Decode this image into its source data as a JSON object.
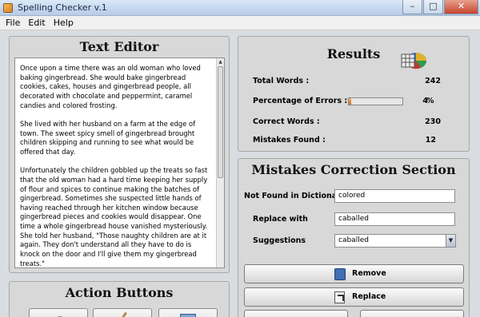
{
  "window": {
    "title": "Spelling Checker v.1",
    "minimize": "–",
    "maximize": "□",
    "close": "✕"
  },
  "menu": [
    "File",
    "Edit",
    "Help"
  ],
  "editor": {
    "title": "Text Editor",
    "paragraphs": [
      "Once upon a time there was an old woman who loved baking gingerbread. She would bake gingerbread cookies, cakes, houses and gingerbread people, all decorated with chocolate and peppermint, caramel candies and colored frosting.",
      "She lived with her husband on a farm at the edge of town. The sweet spicy smell of gingerbread brought children skipping and running to see what would be offered that day.",
      "Unfortunately the children gobbled up the treats so fast that the old woman had a hard time keeping her supply of flour and spices to continue making the batches of gingerbread. Sometimes she suspected little hands of having reached through her kitchen window because gingerbread pieces and cookies would disappear. One time a whole gingerbread house vanished mysteriously. She told her husband, \"Those naughty children are at it again. They don't understand all they have to do is knock on the door and I'll give them my gingerbread treats.\""
    ]
  },
  "actions": {
    "title": "Action Buttons"
  },
  "results": {
    "title": "Results",
    "total_words_label": "Total Words :",
    "total_words": "242",
    "errors_label": "Percentage of Errors :",
    "errors_value": "4",
    "errors_unit": "%",
    "errors_fraction": 0.04,
    "correct_label": "Correct Words :",
    "correct_value": "230",
    "mistakes_label": "Mistakes Found :",
    "mistakes_value": "12"
  },
  "mistakes": {
    "title": "Mistakes Correction Section",
    "not_found_label": "Not Found in Dictionary",
    "not_found_value": "colored",
    "replace_label": "Replace with",
    "replace_value": "caballed",
    "suggestions_label": "Suggestions",
    "suggestions_selected": "caballed",
    "remove_label": "Remove",
    "replace_button_label": "Replace"
  },
  "colors": {
    "accent": "#d96d1c",
    "titlebar": "#c3d6ef",
    "panel": "#d8d8d8"
  }
}
